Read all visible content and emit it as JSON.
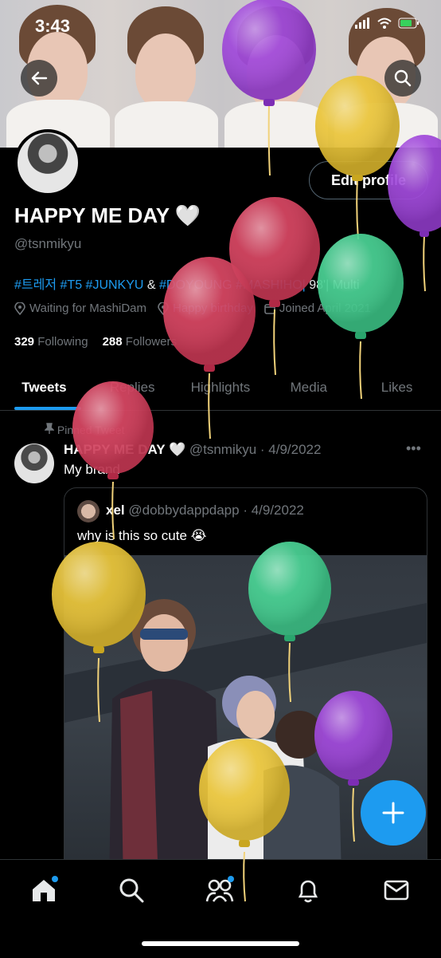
{
  "status_bar": {
    "time": "3:43"
  },
  "profile": {
    "edit_label": "Edit profile",
    "name": "HAPPY ME DAY 🤍",
    "handle": "@tsnmikyu",
    "bio_tags": [
      "#트레저",
      "#T5",
      "#JUNKYU",
      "&",
      "#DOYOUNG",
      "#MASHIHO|",
      "98'|",
      "Multi"
    ],
    "location": "Waiting for MashiDam",
    "birthday": "Happy birthday",
    "joined": "Joined April 2021",
    "following_count": "329",
    "following_label": "Following",
    "followers_count": "288",
    "followers_label": "Followers"
  },
  "tabs": [
    "Tweets",
    "Replies",
    "Highlights",
    "Media",
    "Likes"
  ],
  "active_tab": "Tweets",
  "pinned_tweet": {
    "pinned_label": "Pinned Tweet",
    "author": "HAPPY ME DAY 🤍",
    "handle": "@tsnmikyu",
    "date": "4/9/2022",
    "text": "My brand",
    "quote": {
      "author": "xel",
      "handle": "@dobbydappdapp",
      "date": "4/9/2022",
      "text": "why is this so cute 😭"
    }
  },
  "compose_icon": "plus-icon",
  "bottom_nav": [
    "home-icon",
    "search-icon",
    "communities-icon",
    "notifications-icon",
    "messages-icon"
  ],
  "balloon_colors": [
    "#9b3fd8",
    "#e8c22f",
    "#d63c5a",
    "#3fcf8e"
  ],
  "accent_color": "#1d9bf0"
}
